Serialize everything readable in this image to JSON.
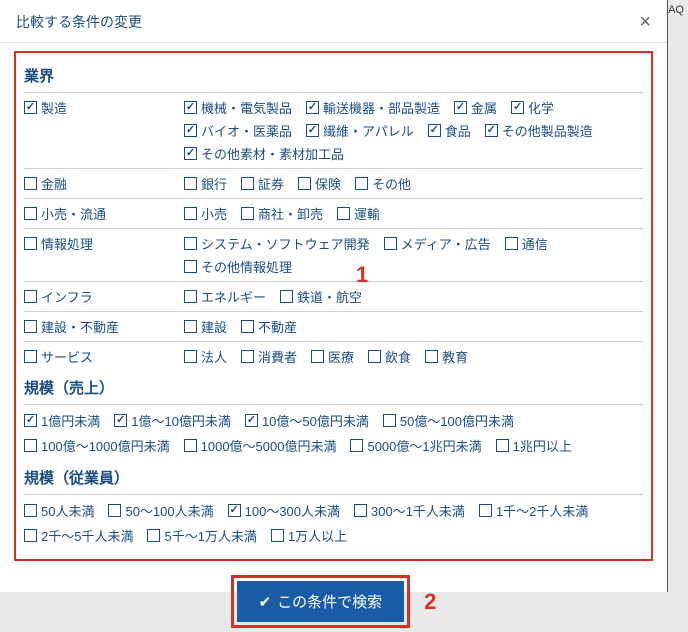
{
  "header": {
    "title": "比較する条件の変更"
  },
  "bgHint": "FAQ",
  "sections": {
    "industry": {
      "title": "業界",
      "rows": [
        {
          "cat": {
            "label": "製造",
            "checked": true
          },
          "items": [
            {
              "label": "機械・電気製品",
              "checked": true
            },
            {
              "label": "輸送機器・部品製造",
              "checked": true
            },
            {
              "label": "金属",
              "checked": true
            },
            {
              "label": "化学",
              "checked": true
            },
            {
              "label": "バイオ・医薬品",
              "checked": true
            },
            {
              "label": "繊維・アパレル",
              "checked": true
            },
            {
              "label": "食品",
              "checked": true
            },
            {
              "label": "その他製品製造",
              "checked": true
            },
            {
              "label": "その他素材・素材加工品",
              "checked": true
            }
          ]
        },
        {
          "cat": {
            "label": "金融",
            "checked": false
          },
          "items": [
            {
              "label": "銀行",
              "checked": false
            },
            {
              "label": "証券",
              "checked": false
            },
            {
              "label": "保険",
              "checked": false
            },
            {
              "label": "その他",
              "checked": false
            }
          ]
        },
        {
          "cat": {
            "label": "小売・流通",
            "checked": false
          },
          "items": [
            {
              "label": "小売",
              "checked": false
            },
            {
              "label": "商社・卸売",
              "checked": false
            },
            {
              "label": "運輸",
              "checked": false
            }
          ]
        },
        {
          "cat": {
            "label": "情報処理",
            "checked": false
          },
          "items": [
            {
              "label": "システム・ソフトウェア開発",
              "checked": false
            },
            {
              "label": "メディア・広告",
              "checked": false
            },
            {
              "label": "通信",
              "checked": false
            },
            {
              "label": "その他情報処理",
              "checked": false
            }
          ]
        },
        {
          "cat": {
            "label": "インフラ",
            "checked": false
          },
          "items": [
            {
              "label": "エネルギー",
              "checked": false
            },
            {
              "label": "鉄道・航空",
              "checked": false
            }
          ]
        },
        {
          "cat": {
            "label": "建設・不動産",
            "checked": false
          },
          "items": [
            {
              "label": "建設",
              "checked": false
            },
            {
              "label": "不動産",
              "checked": false
            }
          ]
        },
        {
          "cat": {
            "label": "サービス",
            "checked": false
          },
          "items": [
            {
              "label": "法人",
              "checked": false
            },
            {
              "label": "消費者",
              "checked": false
            },
            {
              "label": "医療",
              "checked": false
            },
            {
              "label": "飲食",
              "checked": false
            },
            {
              "label": "教育",
              "checked": false
            }
          ]
        }
      ]
    },
    "revenue": {
      "title": "規模（売上）",
      "items": [
        {
          "label": "1億円未満",
          "checked": true
        },
        {
          "label": "1億〜10億円未満",
          "checked": true
        },
        {
          "label": "10億〜50億円未満",
          "checked": true
        },
        {
          "label": "50億〜100億円未満",
          "checked": false
        },
        {
          "label": "100億〜1000億円未満",
          "checked": false
        },
        {
          "label": "1000億〜5000億円未満",
          "checked": false
        },
        {
          "label": "5000億〜1兆円未満",
          "checked": false
        },
        {
          "label": "1兆円以上",
          "checked": false
        }
      ]
    },
    "employees": {
      "title": "規模（従業員）",
      "items": [
        {
          "label": "50人未満",
          "checked": false
        },
        {
          "label": "50〜100人未満",
          "checked": false
        },
        {
          "label": "100〜300人未満",
          "checked": true
        },
        {
          "label": "300〜1千人未満",
          "checked": false
        },
        {
          "label": "1千〜2千人未満",
          "checked": false
        },
        {
          "label": "2千〜5千人未満",
          "checked": false
        },
        {
          "label": "5千〜1万人未満",
          "checked": false
        },
        {
          "label": "1万人以上",
          "checked": false
        }
      ]
    }
  },
  "callouts": {
    "one": "1",
    "two": "2"
  },
  "footer": {
    "searchLabel": "この条件で検索"
  }
}
